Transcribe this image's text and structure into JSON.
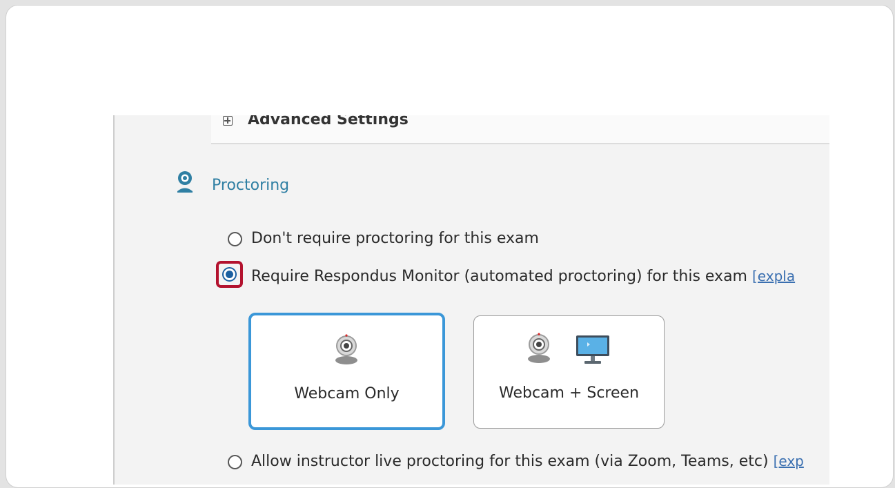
{
  "advanced": {
    "label": "Advanced Settings",
    "icon": "plus-square-icon"
  },
  "proctoring": {
    "heading": "Proctoring",
    "icon": "webcam-icon",
    "options": [
      {
        "label": "Don't require proctoring for this exam",
        "selected": false
      },
      {
        "label": "Require Respondus Monitor (automated proctoring) for this exam",
        "link": "[expla",
        "selected": true
      },
      {
        "label": "Allow instructor live proctoring for this exam (via Zoom, Teams, etc)",
        "link": "[exp",
        "selected": false
      }
    ],
    "modes": [
      {
        "label": "Webcam Only",
        "selected": true,
        "icons": [
          "webcam-icon"
        ]
      },
      {
        "label": "Webcam + Screen",
        "selected": false,
        "icons": [
          "webcam-icon",
          "monitor-icon"
        ]
      }
    ]
  },
  "colors": {
    "accent": "#3b97d8",
    "highlight": "#b3122e",
    "heading": "#2f7fa3",
    "radio": "#1a5fa0"
  }
}
